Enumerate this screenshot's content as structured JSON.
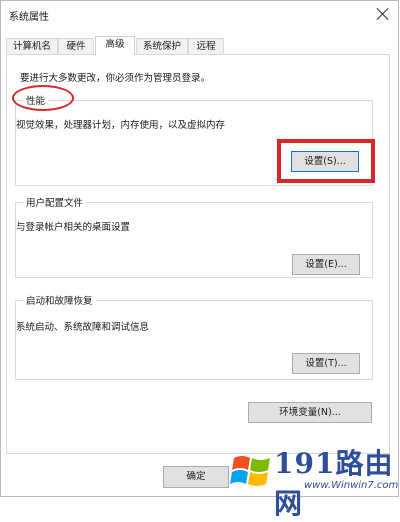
{
  "window": {
    "title": "系统属性"
  },
  "tabs": [
    "计算机名",
    "硬件",
    "高级",
    "系统保护",
    "远程"
  ],
  "notice": "要进行大多数更改，你必须作为管理员登录。",
  "groups": {
    "performance": {
      "label": "性能",
      "desc": "视觉效果，处理器计划，内存使用，以及虚拟内存",
      "button": "设置(S)..."
    },
    "profile": {
      "label": "用户配置文件",
      "desc": "与登录帐户相关的桌面设置",
      "button": "设置(E)..."
    },
    "startup": {
      "label": "启动和故障恢复",
      "desc": "系统启动、系统故障和调试信息",
      "button": "设置(T)..."
    }
  },
  "env_button": "环境变量(N)...",
  "ok_button": "确定",
  "watermark": {
    "brand": "191路由网",
    "url": "www.Winwin7.com"
  },
  "colors": {
    "annotation_red": "#d9262a",
    "watermark_blue": "#2d4e9a",
    "focus_blue": "#0078d7"
  }
}
